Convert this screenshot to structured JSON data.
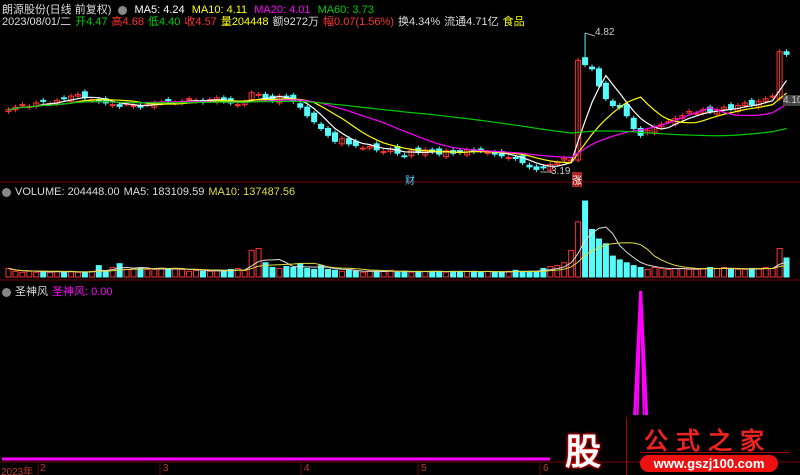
{
  "header": {
    "title": "朗源股份(日线 前复权)",
    "ma5": "MA5: 4.24",
    "ma10": "MA10: 4.11",
    "ma20": "MA20: 4.01",
    "ma60": "MA60: 3.73"
  },
  "quote": {
    "date": "2023/08/01/二",
    "open_l": "开",
    "open": "4.47",
    "high_l": "高",
    "high": "4.68",
    "low_l": "低",
    "low": "4.40",
    "close_l": "收",
    "close": "4.57",
    "vol_l": "量",
    "vol": "204448",
    "amt": "额9272万",
    "chg_l": "幅",
    "chg": "0.07(1.56%)",
    "turnover": "换4.34%",
    "float": "流通4.71亿",
    "sector": "食品"
  },
  "volume_header": {
    "volume": "VOLUME: 204448.00",
    "ma5": "MA5: 183109.59",
    "ma10": "MA10: 137487.56"
  },
  "indicator_header": {
    "name": "圣神风",
    "value_label": "圣神风: 0.00"
  },
  "annotations": {
    "high": "4.82",
    "low": "3.19",
    "last": "4.10",
    "tag_cai": "财",
    "tag_zhang": "涨"
  },
  "logo": {
    "char": "股",
    "text": "公式之家",
    "url": "www.gszj100.com"
  },
  "colors": {
    "up": "#ff3333",
    "down": "#54fcfc",
    "ma5": "#ffffff",
    "ma10": "#ffff00",
    "ma20": "#ff00ff",
    "ma60": "#00cc00",
    "indicator": "#ff00ff"
  },
  "chart_data": {
    "type": "candlestick",
    "x_labels": [
      "2023年",
      "2",
      "3",
      "4",
      "5",
      "6"
    ],
    "closes": [
      3.92,
      3.95,
      3.98,
      3.96,
      4.0,
      4.02,
      3.99,
      4.03,
      4.05,
      4.08,
      4.1,
      4.06,
      4.04,
      4.02,
      4.0,
      3.98,
      3.96,
      3.99,
      3.97,
      3.95,
      3.98,
      4.0,
      4.01,
      4.03,
      4.0,
      4.02,
      4.05,
      4.03,
      4.01,
      4.04,
      4.06,
      4.02,
      4.0,
      3.98,
      4.01,
      4.12,
      4.1,
      4.05,
      4.03,
      4.08,
      4.06,
      4.02,
      3.95,
      3.85,
      3.78,
      3.7,
      3.62,
      3.55,
      3.58,
      3.52,
      3.5,
      3.47,
      3.49,
      3.45,
      3.43,
      3.46,
      3.41,
      3.38,
      3.44,
      3.42,
      3.45,
      3.43,
      3.4,
      3.44,
      3.41,
      3.42,
      3.45,
      3.43,
      3.44,
      3.42,
      3.4,
      3.38,
      3.36,
      3.35,
      3.3,
      3.25,
      3.22,
      3.24,
      3.28,
      3.3,
      3.35,
      3.33,
      4.5,
      4.45,
      4.4,
      4.2,
      4.05,
      3.97,
      3.95,
      3.85,
      3.7,
      3.62,
      3.68,
      3.72,
      3.75,
      3.78,
      3.82,
      3.85,
      3.9,
      3.88,
      3.92,
      3.9,
      3.92,
      3.95,
      3.93,
      3.97,
      4.0,
      3.98,
      4.02,
      4.05,
      4.08,
      4.6,
      4.57
    ],
    "volumes": [
      9,
      6,
      5,
      6,
      5,
      6,
      5,
      6,
      5,
      6,
      5,
      5,
      6,
      12,
      6,
      10,
      14,
      8,
      9,
      9,
      8,
      8,
      9,
      8,
      9,
      8,
      6,
      7,
      6,
      6,
      7,
      6,
      8,
      9,
      7,
      28,
      30,
      15,
      10,
      9,
      11,
      10,
      14,
      9,
      8,
      12,
      8,
      7,
      6,
      7,
      6,
      5,
      6,
      6,
      6,
      7,
      5,
      6,
      5,
      6,
      6,
      6,
      6,
      5,
      6,
      6,
      6,
      6,
      5,
      6,
      5,
      5,
      6,
      7,
      6,
      6,
      6,
      9,
      11,
      12,
      15,
      28,
      58,
      80,
      50,
      40,
      35,
      22,
      18,
      15,
      12,
      10,
      8,
      10,
      9,
      8,
      9,
      9,
      8,
      8,
      9,
      10,
      9,
      10,
      8,
      8,
      8,
      9,
      9,
      10,
      9,
      30,
      20
    ],
    "price_range": [
      3.19,
      4.82
    ],
    "indicator_values_peak_index": 91
  }
}
